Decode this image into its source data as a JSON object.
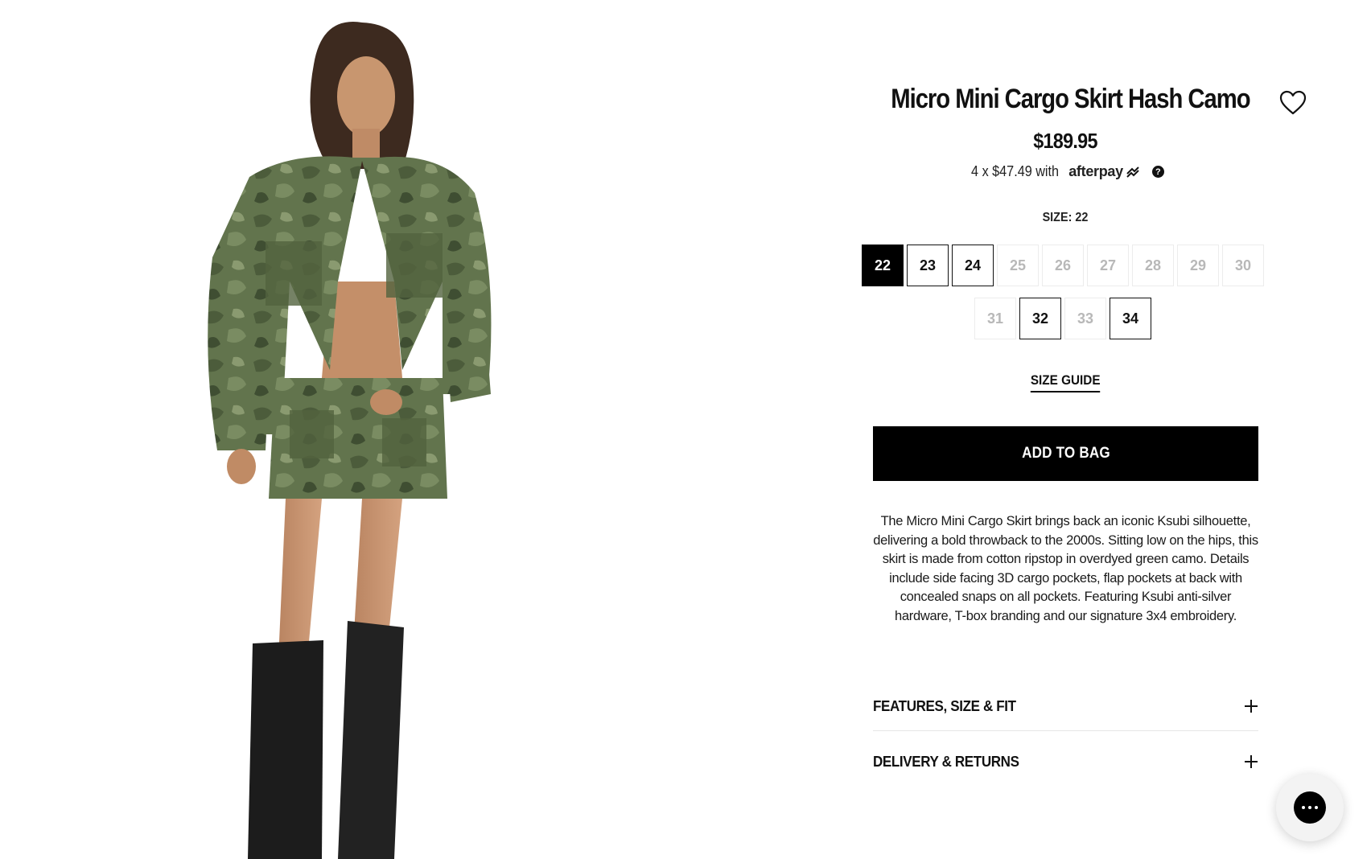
{
  "product": {
    "title": "Micro Mini Cargo Skirt Hash Camo",
    "price": "$189.95",
    "installments_text": "4 x $47.49 with",
    "afterpay_brand": "afterpay",
    "help_symbol": "?"
  },
  "size": {
    "label": "SIZE: 22",
    "options": [
      {
        "value": "22",
        "state": "selected"
      },
      {
        "value": "23",
        "state": "available"
      },
      {
        "value": "24",
        "state": "available"
      },
      {
        "value": "25",
        "state": "unavailable"
      },
      {
        "value": "26",
        "state": "unavailable"
      },
      {
        "value": "27",
        "state": "unavailable"
      },
      {
        "value": "28",
        "state": "unavailable"
      },
      {
        "value": "29",
        "state": "unavailable"
      },
      {
        "value": "30",
        "state": "unavailable"
      },
      {
        "value": "31",
        "state": "unavailable"
      },
      {
        "value": "32",
        "state": "available"
      },
      {
        "value": "33",
        "state": "unavailable"
      },
      {
        "value": "34",
        "state": "available"
      }
    ],
    "guide_label": "SIZE GUIDE"
  },
  "actions": {
    "add_to_bag": "ADD TO BAG"
  },
  "description": "The Micro Mini Cargo Skirt brings back an iconic Ksubi silhouette, delivering a bold throwback to the 2000s. Sitting low on the hips, this skirt is made from cotton ripstop in overdyed green camo. Details include side facing 3D cargo pockets, flap pockets at back with concealed snaps on all pockets. Featuring Ksubi anti-silver hardware, T-box branding and our signature 3x4 embroidery.",
  "accordions": [
    {
      "label": "FEATURES, SIZE & FIT",
      "icon": "plus-icon"
    },
    {
      "label": "DELIVERY & RETURNS",
      "icon": "plus-icon"
    }
  ],
  "icons": {
    "wishlist": "heart-icon",
    "chat": "chat-icon"
  },
  "colors": {
    "accent": "#000000",
    "camo_green": "#5d7049",
    "unavailable_text": "#b8b8b8"
  }
}
